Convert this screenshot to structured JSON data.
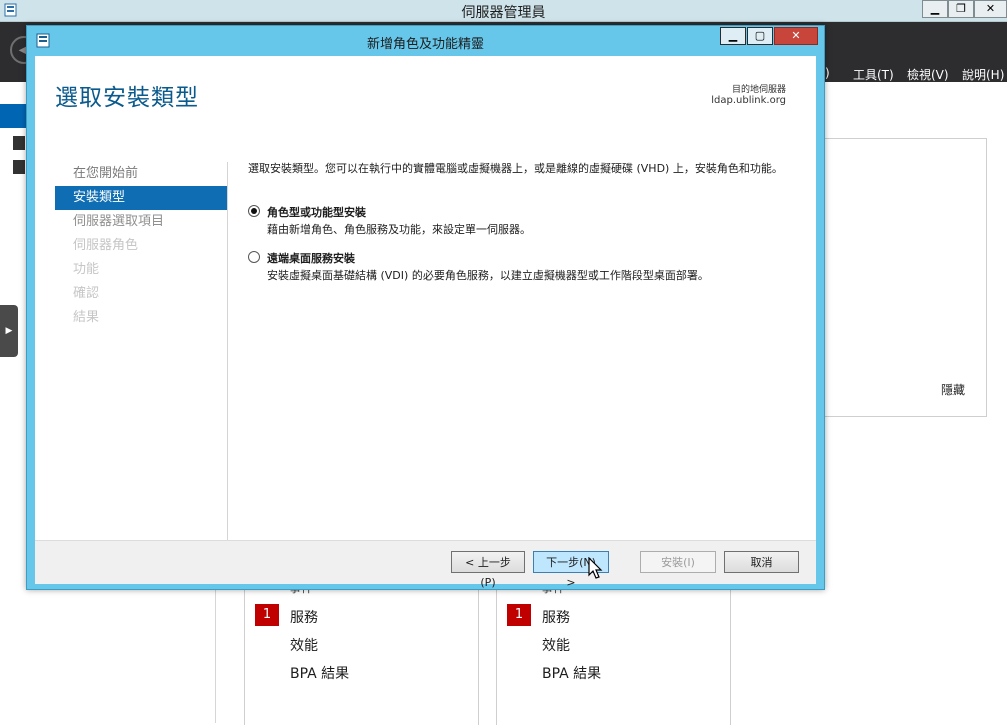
{
  "background": {
    "title": "伺服器管理員",
    "menu_partial": ")",
    "menu_tools": "工具(T)",
    "menu_view": "檢視(V)",
    "menu_help": "說明(H)",
    "hide_label": "隱藏",
    "cards": [
      {
        "cut_text": "事件",
        "badge": "1",
        "services": "服務",
        "performance": "效能",
        "bpa": "BPA 結果"
      },
      {
        "cut_text": "事件",
        "badge": "1",
        "services": "服務",
        "performance": "效能",
        "bpa": "BPA 結果"
      }
    ]
  },
  "wizard": {
    "title": "新增角色及功能精靈",
    "heading": "選取安裝類型",
    "destination_label": "目的地伺服器",
    "destination_server": "ldap.ublink.org",
    "nav": [
      {
        "label": "在您開始前",
        "state": "done"
      },
      {
        "label": "安裝類型",
        "state": "active"
      },
      {
        "label": "伺服器選取項目",
        "state": "next"
      },
      {
        "label": "伺服器角色",
        "state": "disabled"
      },
      {
        "label": "功能",
        "state": "disabled"
      },
      {
        "label": "確認",
        "state": "disabled"
      },
      {
        "label": "結果",
        "state": "disabled"
      }
    ],
    "description": "選取安裝類型。您可以在執行中的實體電腦或虛擬機器上，或是離線的虛擬硬碟 (VHD) 上，安裝角色和功能。",
    "options": [
      {
        "title": "角色型或功能型安裝",
        "desc": "藉由新增角色、角色服務及功能，來設定單一伺服器。",
        "checked": true
      },
      {
        "title": "遠端桌面服務安裝",
        "desc": "安裝虛擬桌面基礎結構 (VDI) 的必要角色服務，以建立虛擬機器型或工作階段型桌面部署。",
        "checked": false
      }
    ],
    "buttons": {
      "previous": "< 上一步(P)",
      "next": "下一步(N) >",
      "install": "安裝(I)",
      "cancel": "取消"
    }
  },
  "colors": {
    "accent": "#0f6db3",
    "frame": "#66c7ea",
    "header": "#2d2d30",
    "badge": "#c00000"
  }
}
